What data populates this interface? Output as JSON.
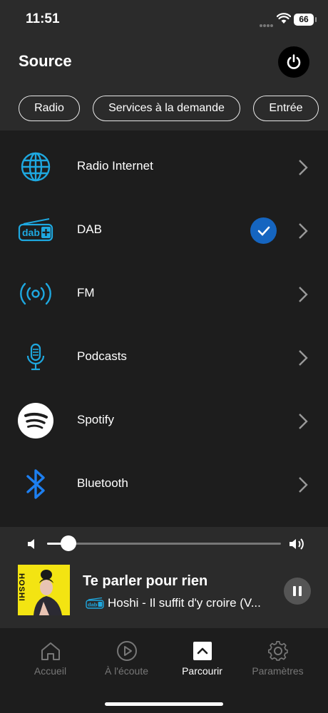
{
  "status_bar": {
    "time": "11:51",
    "battery": "66"
  },
  "header": {
    "title": "Source"
  },
  "tabs": [
    {
      "label": "Radio"
    },
    {
      "label": "Services à la demande"
    },
    {
      "label": "Entrée"
    }
  ],
  "sources": [
    {
      "label": "Radio Internet",
      "icon": "globe-icon",
      "selected": false
    },
    {
      "label": "DAB",
      "icon": "dab-plus-icon",
      "selected": true
    },
    {
      "label": "FM",
      "icon": "fm-radio-waves-icon",
      "selected": false
    },
    {
      "label": "Podcasts",
      "icon": "microphone-icon",
      "selected": false
    },
    {
      "label": "Spotify",
      "icon": "spotify-icon",
      "selected": false
    },
    {
      "label": "Bluetooth",
      "icon": "bluetooth-icon",
      "selected": false
    }
  ],
  "now_playing": {
    "volume_level": 0.09,
    "title": "Te parler pour rien",
    "subtitle": "Hoshi - Il suffit d'y croire (V...",
    "album_art_text": "HOSHI"
  },
  "bottom_nav": [
    {
      "label": "Accueil",
      "icon": "home-icon",
      "active": false
    },
    {
      "label": "À l'écoute",
      "icon": "play-circle-icon",
      "active": false
    },
    {
      "label": "Parcourir",
      "icon": "browse-icon",
      "active": true
    },
    {
      "label": "Paramètres",
      "icon": "gear-icon",
      "active": false
    }
  ],
  "colors": {
    "accent": "#1ea8e0",
    "selected": "#1565c0",
    "bluetooth": "#1d7ff0",
    "background": "#1d1d1d",
    "panel": "#2b2b2b"
  }
}
